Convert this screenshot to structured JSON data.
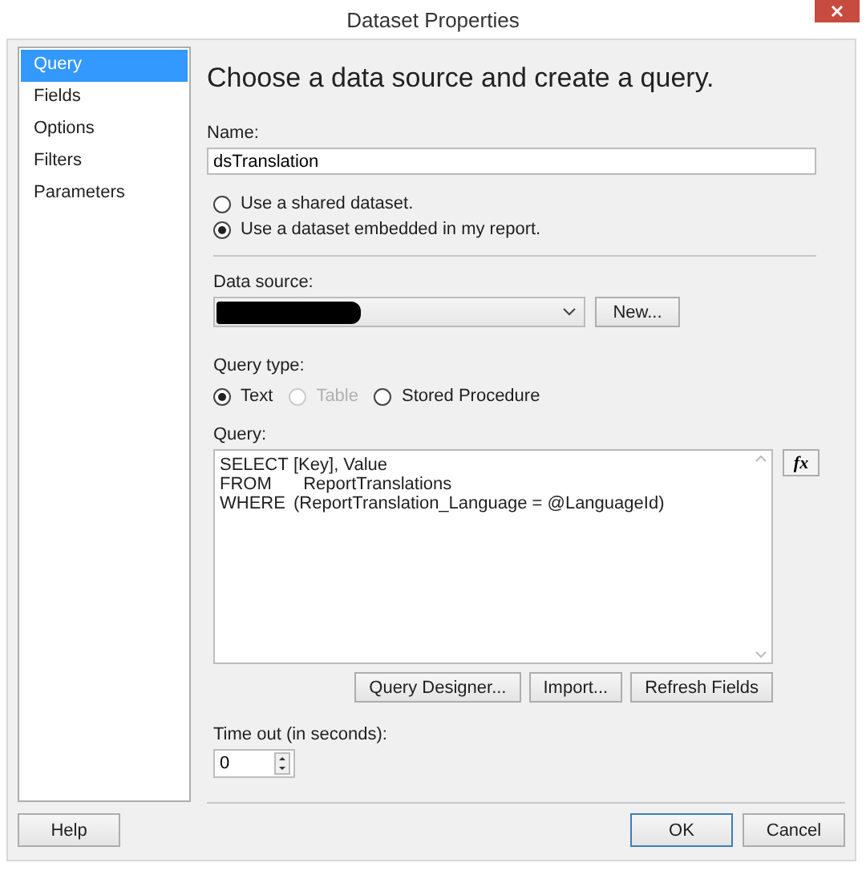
{
  "window": {
    "title": "Dataset Properties"
  },
  "sidebar": {
    "items": [
      {
        "label": "Query",
        "selected": true
      },
      {
        "label": "Fields",
        "selected": false
      },
      {
        "label": "Options",
        "selected": false
      },
      {
        "label": "Filters",
        "selected": false
      },
      {
        "label": "Parameters",
        "selected": false
      }
    ]
  },
  "heading": "Choose a data source and create a query.",
  "name": {
    "label": "Name:",
    "value": "dsTranslation"
  },
  "dataset_options": [
    {
      "label": "Use a shared dataset.",
      "selected": false
    },
    {
      "label": "Use a dataset embedded in my report.",
      "selected": true
    }
  ],
  "data_source": {
    "label": "Data source:",
    "redacted": true,
    "button": "New..."
  },
  "query_type": {
    "label": "Query type:",
    "options": [
      {
        "label": "Text",
        "selected": true,
        "disabled": false
      },
      {
        "label": "Table",
        "selected": false,
        "disabled": true
      },
      {
        "label": "Stored Procedure",
        "selected": false,
        "disabled": false
      }
    ]
  },
  "query": {
    "label": "Query:",
    "lines": [
      {
        "keyword": "SELECT",
        "text": "[Key], Value"
      },
      {
        "keyword": "FROM",
        "text": "  ReportTranslations"
      },
      {
        "keyword": "WHERE",
        "text": "(ReportTranslation_Language = @LanguageId)"
      }
    ],
    "expression_button": "fx",
    "buttons": [
      "Query Designer...",
      "Import...",
      "Refresh Fields"
    ]
  },
  "timeout": {
    "label": "Time out (in seconds):",
    "value": "0"
  },
  "footer": {
    "help": "Help",
    "ok": "OK",
    "cancel": "Cancel"
  }
}
